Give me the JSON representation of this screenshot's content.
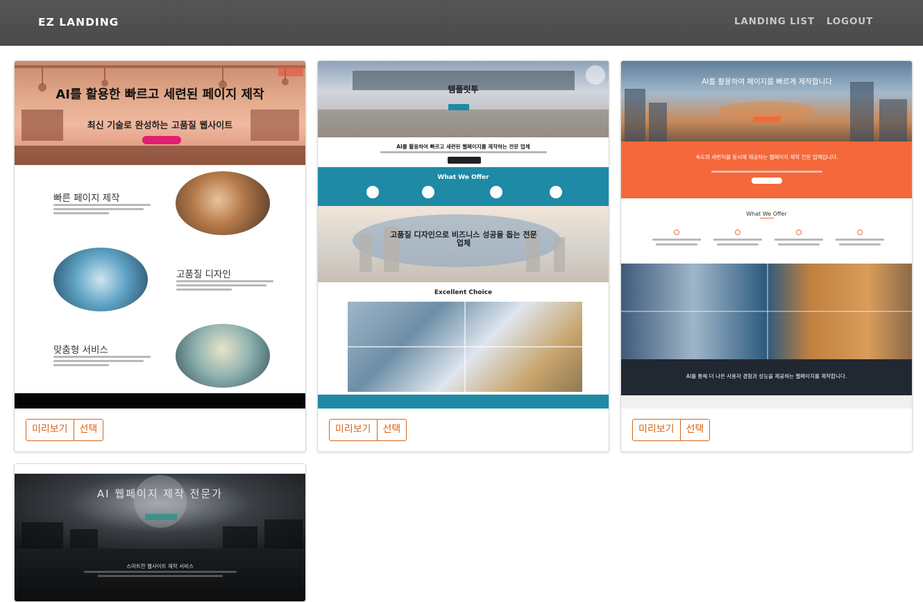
{
  "navbar": {
    "brand": "EZ LANDING",
    "links": [
      "LANDING LIST",
      "LOGOUT"
    ]
  },
  "colors": {
    "navbar_bg": "#4f4f4f",
    "accent": "#d4661b"
  },
  "card_actions": {
    "preview": "미리보기",
    "select": "선택"
  },
  "templates": [
    {
      "hero_title": "AI를 활용한 빠르고 세련된 페이지 제작",
      "hero_subtitle": "최신 기술로 완성하는 고품질 웹사이트",
      "features": [
        "빠른 페이지 제작",
        "고품질 디자인",
        "맞춤형 서비스"
      ]
    },
    {
      "hero_title": "템플릿투",
      "headline": "AI를 활용하여 빠르고 세련된 웹페이지를 제작하는 전문 업체",
      "section_offer": "What We Offer",
      "city_title": "고품질 디자인으로 비즈니스 성공을 돕는 전문 업체",
      "section_choice": "Excellent Choice"
    },
    {
      "hero_title": "AI를 활용하여 페이지를 빠르게 제작합니다",
      "orange_text": "속도와 세련미를 동시에 제공하는 웹페이지 제작 전문 업체입니다.",
      "section_offer": "What We Offer",
      "dark_text": "AI를 통해 더 나은 사용자 경험과 성능을 제공하는 웹페이지를 제작합니다."
    },
    {
      "hero_title": "AI 웹페이지 제작 전문가",
      "dark_title": "스마트한 웹사이트 제작 서비스"
    }
  ]
}
